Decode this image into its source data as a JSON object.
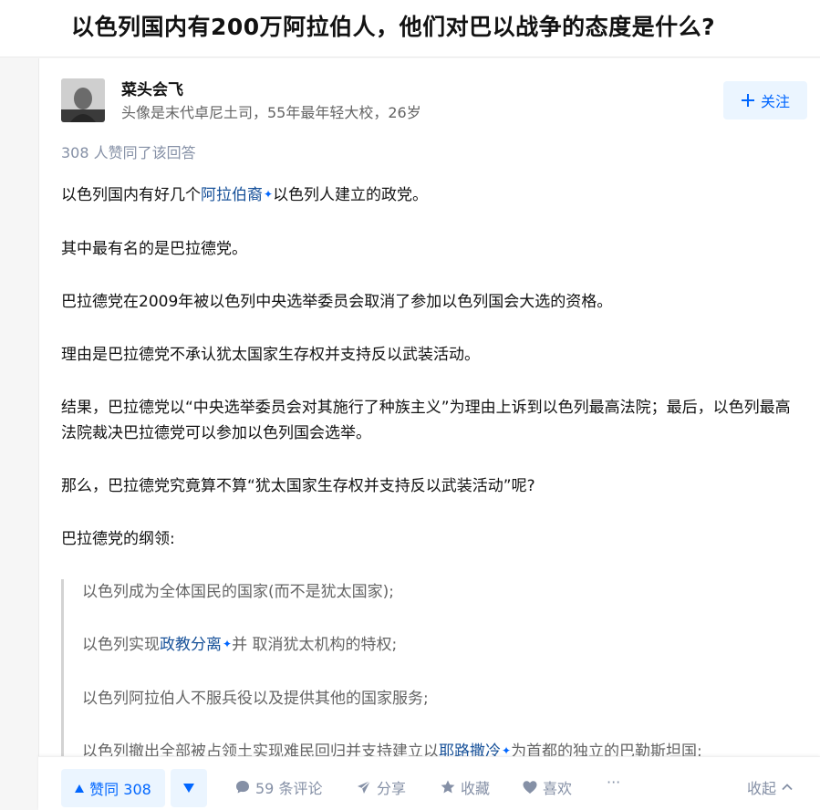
{
  "question": {
    "title": "以色列国内有200万阿拉伯人，他们对巴以战争的态度是什么?"
  },
  "author": {
    "name": "菜头会飞",
    "bio": "头像是末代卓尼土司，55年最年轻大校，26岁",
    "follow_label": "关注"
  },
  "answer": {
    "voters_text": "308 人赞同了该回答",
    "p1_before": "以色列国内有好几个",
    "p1_link": "阿拉伯裔",
    "p1_after": "以色列人建立的政党。",
    "p2": "其中最有名的是巴拉德党。",
    "p3": "巴拉德党在2009年被以色列中央选举委员会取消了参加以色列国会大选的资格。",
    "p4": "理由是巴拉德党不承认犹太国家生存权并支持反以武装活动。",
    "p5": "结果，巴拉德党以“中央选举委员会对其施行了种族主义”为理由上诉到以色列最高法院；最后，以色列最高法院裁决巴拉德党可以参加以色列国会选举。",
    "p6": "那么，巴拉德党究竟算不算“犹太国家生存权并支持反以武装活动”呢?",
    "p7": "巴拉德党的纲领:",
    "q1": "以色列成为全体国民的国家(而不是犹太国家);",
    "q2_before": "以色列实现",
    "q2_link": "政教分离",
    "q2_after": "并 取消犹太机构的特权;",
    "q3": "以色列阿拉伯人不服兵役以及提供其他的国家服务;",
    "q4_before": "以色列撤出全部被占领土实现难民回归并支持建立以",
    "q4_link": "耶路撒冷",
    "q4_after": "为首都的独立的巴勒斯坦国;"
  },
  "actions": {
    "vote_label": "赞同 308",
    "comment_label": "59 条评论",
    "share_label": "分享",
    "collect_label": "收藏",
    "like_label": "喜欢",
    "more_label": "···",
    "collapse_label": "收起"
  },
  "colors": {
    "accent": "#0066ff",
    "link": "#175199",
    "muted": "#8590a6",
    "accent_bg": "#ebf5ff"
  }
}
